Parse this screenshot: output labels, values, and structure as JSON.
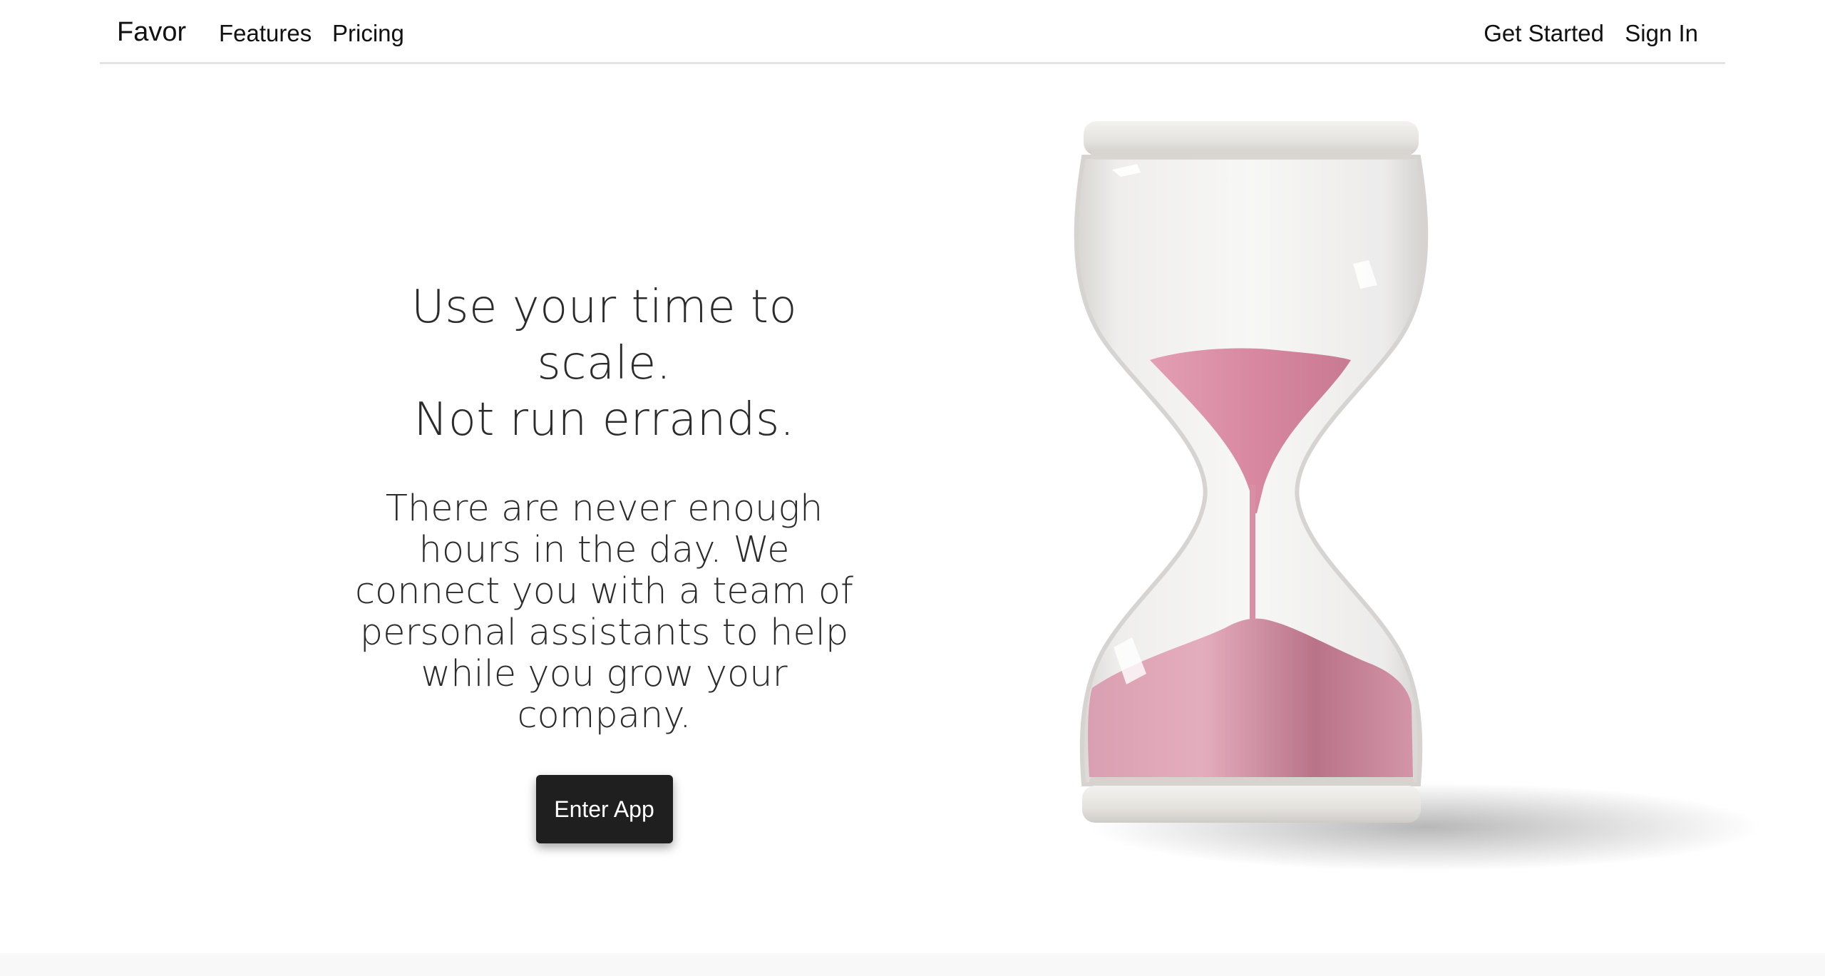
{
  "nav": {
    "brand": "Favor",
    "links": [
      "Features",
      "Pricing"
    ],
    "right_links": [
      "Get Started",
      "Sign In"
    ]
  },
  "hero": {
    "headline_line1": "Use your time to scale.",
    "headline_line2": "Not run errands.",
    "body": "There are never enough hours in the day. We connect you with a team of personal assistants to help while you grow your company.",
    "cta_label": "Enter App"
  },
  "illustration": {
    "icon": "hourglass-icon",
    "sand_color": "#d98aa2",
    "glass_color": "#f4f3f1",
    "cap_color": "#e6e4e0"
  }
}
